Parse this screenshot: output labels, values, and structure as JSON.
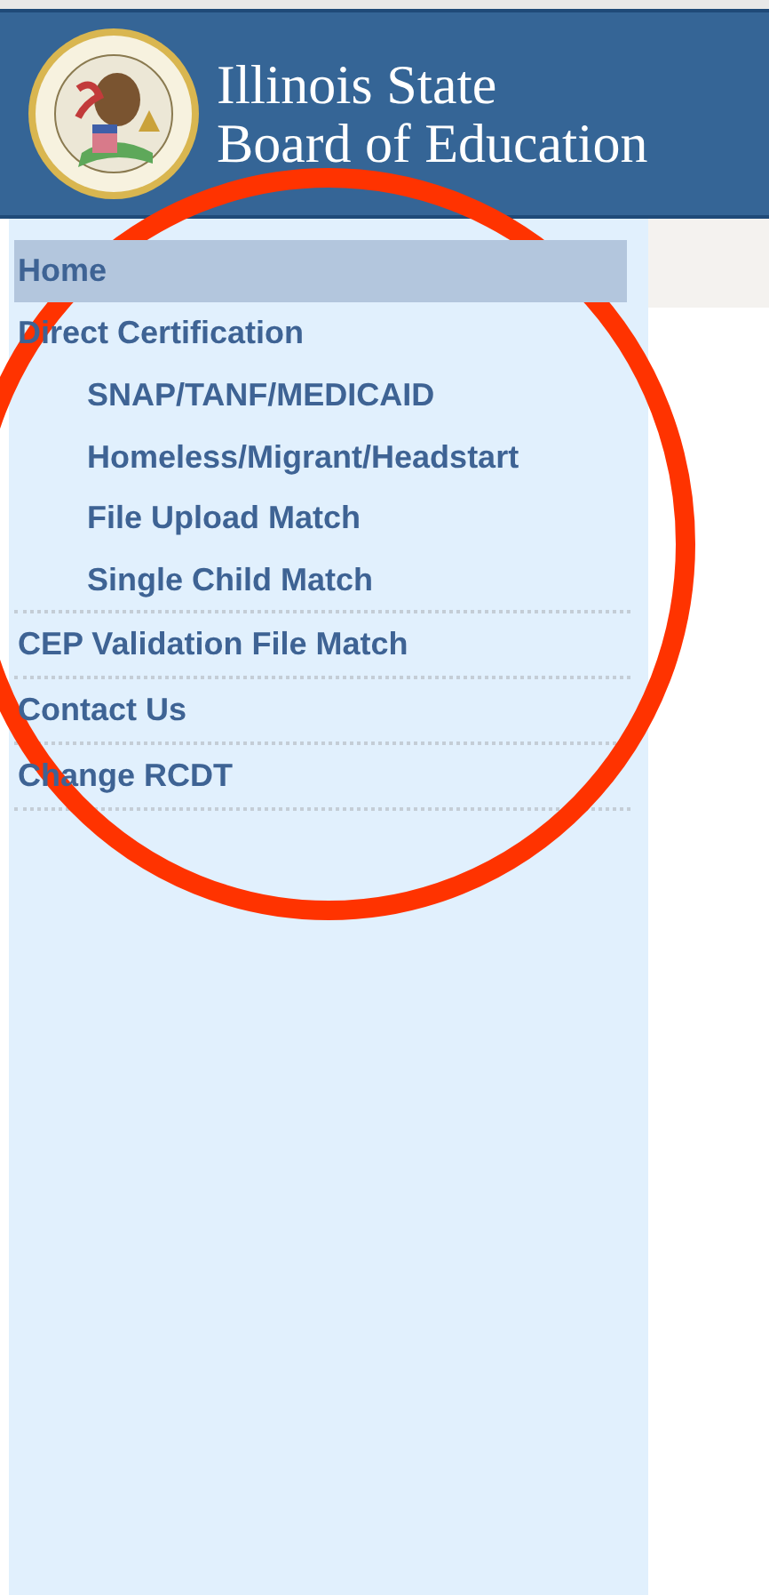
{
  "header": {
    "title_lines": [
      "Illinois State",
      "Board of Education"
    ]
  },
  "sidebar": {
    "items": [
      {
        "label": "Home",
        "selected": true
      },
      {
        "label": "Direct Certification",
        "selected": false,
        "children": [
          {
            "label": "SNAP/TANF/MEDICAID",
            "selected": false
          },
          {
            "label": "Homeless/Migrant/Headstart",
            "selected": false
          },
          {
            "label": "File Upload Match",
            "selected": false
          },
          {
            "label": "Single Child Match",
            "selected": false
          }
        ]
      },
      {
        "label": "CEP Validation File Match",
        "selected": false
      },
      {
        "label": "Contact Us",
        "selected": false
      },
      {
        "label": "Change RCDT",
        "selected": false
      }
    ]
  }
}
